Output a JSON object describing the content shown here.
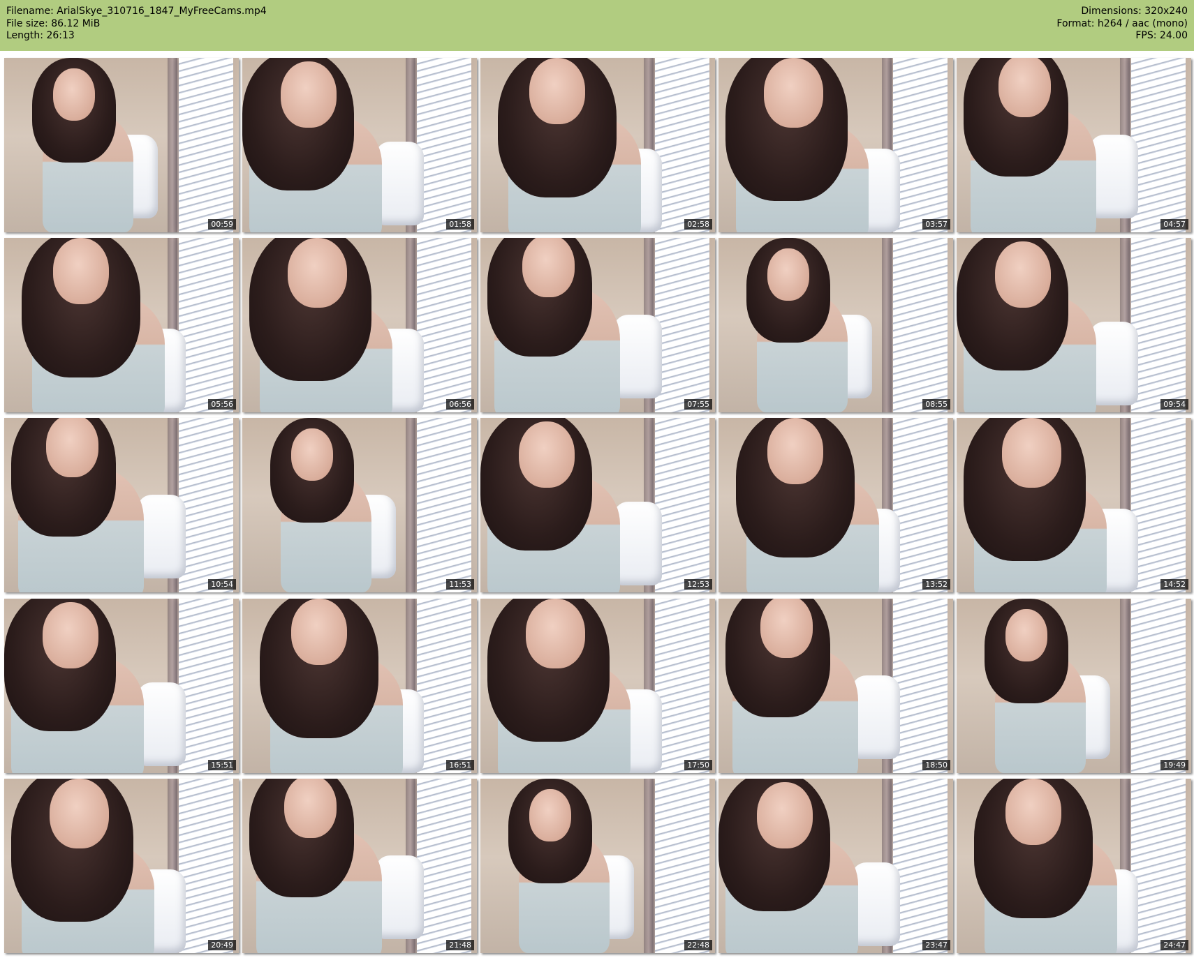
{
  "header": {
    "filename_line": "Filename: ArialSkye_310716_1847_MyFreeCams.mp4",
    "filesize_line": "File size: 86.12 MiB",
    "length_line": "Length: 26:13",
    "dimensions_line": "Dimensions: 320x240",
    "format_line": "Format: h264 / aac (mono)",
    "fps_line": "FPS: 24.00",
    "background_color": "#b1cc80"
  },
  "thumbnails": [
    {
      "timestamp": "00:59"
    },
    {
      "timestamp": "01:58"
    },
    {
      "timestamp": "02:58"
    },
    {
      "timestamp": "03:57"
    },
    {
      "timestamp": "04:57"
    },
    {
      "timestamp": "05:56"
    },
    {
      "timestamp": "06:56"
    },
    {
      "timestamp": "07:55"
    },
    {
      "timestamp": "08:55"
    },
    {
      "timestamp": "09:54"
    },
    {
      "timestamp": "10:54"
    },
    {
      "timestamp": "11:53"
    },
    {
      "timestamp": "12:53"
    },
    {
      "timestamp": "13:52"
    },
    {
      "timestamp": "14:52"
    },
    {
      "timestamp": "15:51"
    },
    {
      "timestamp": "16:51"
    },
    {
      "timestamp": "17:50"
    },
    {
      "timestamp": "18:50"
    },
    {
      "timestamp": "19:49"
    },
    {
      "timestamp": "20:49"
    },
    {
      "timestamp": "21:48"
    },
    {
      "timestamp": "22:48"
    },
    {
      "timestamp": "23:47"
    },
    {
      "timestamp": "24:47"
    }
  ]
}
